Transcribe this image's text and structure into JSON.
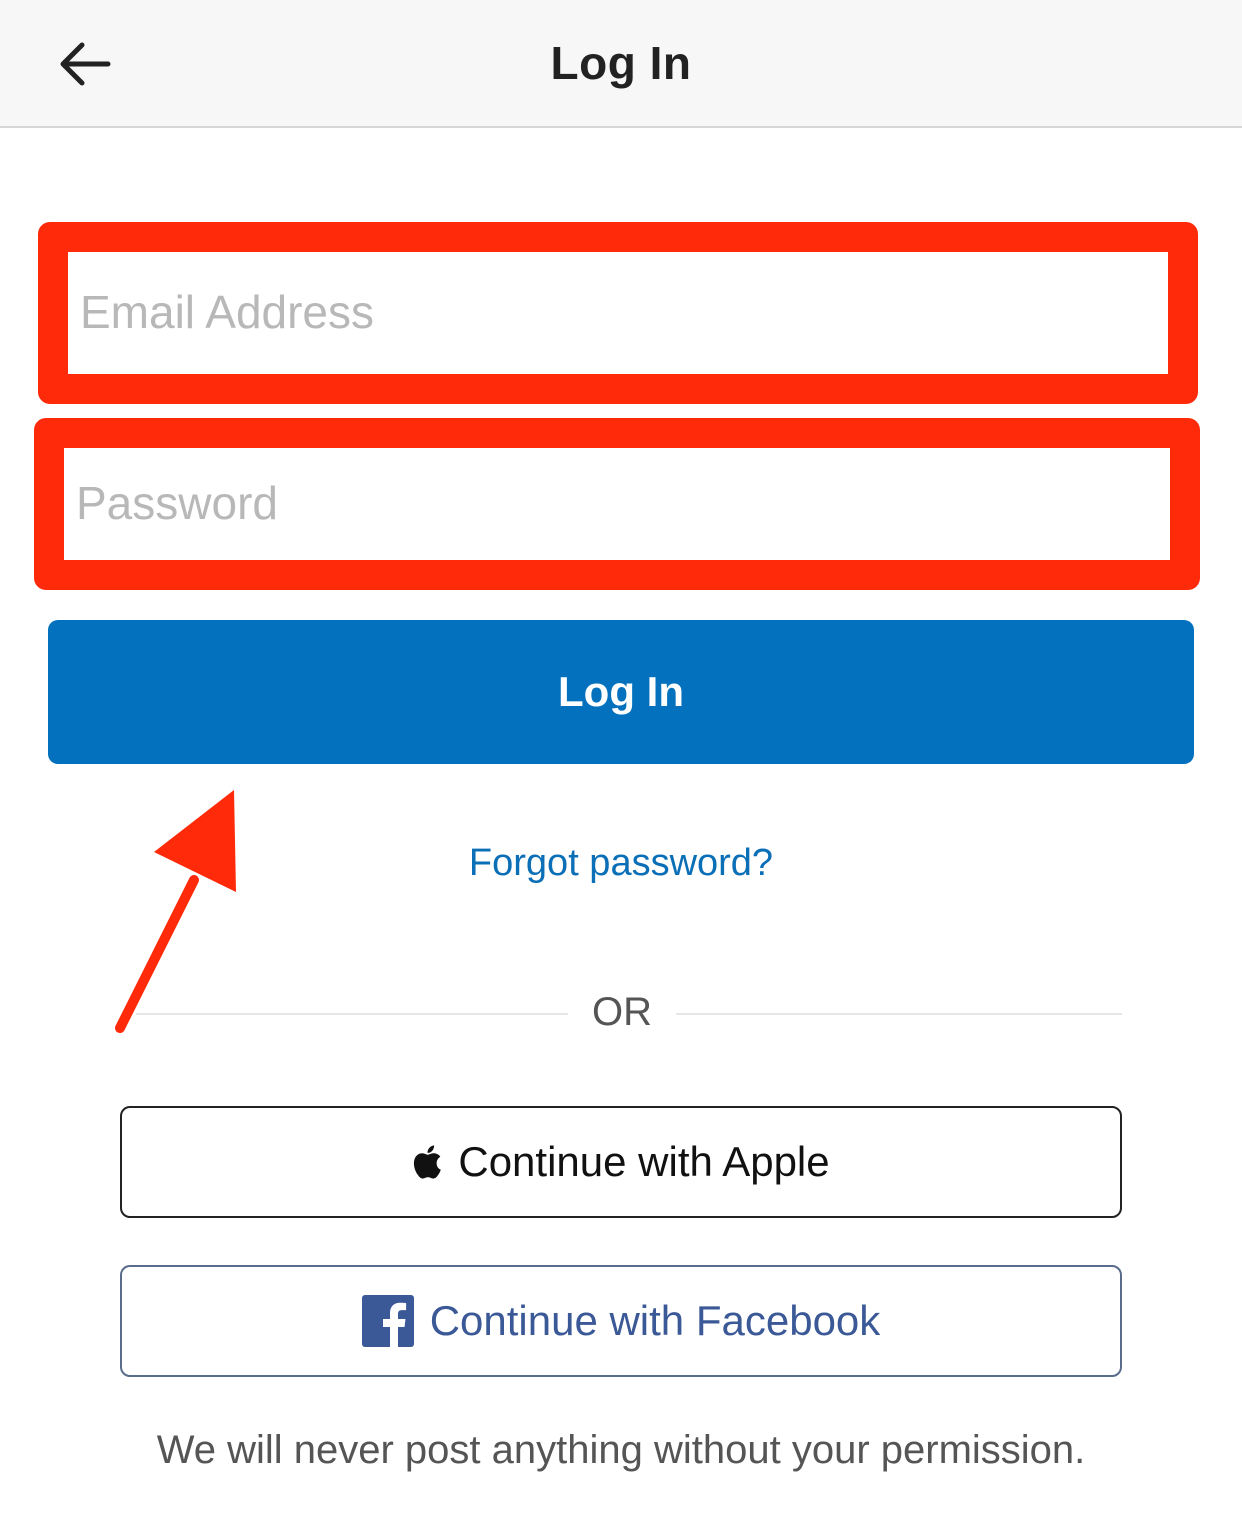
{
  "header": {
    "title": "Log In",
    "back_icon": "arrow-left-icon"
  },
  "form": {
    "email_placeholder": "Email Address",
    "email_value": "",
    "password_placeholder": "Password",
    "password_value": "",
    "login_label": "Log In",
    "forgot_label": "Forgot password?"
  },
  "divider": {
    "label": "OR"
  },
  "social": {
    "apple_label": "Continue with Apple",
    "apple_icon": "apple-logo-icon",
    "facebook_label": "Continue with Facebook",
    "facebook_icon": "facebook-logo-icon"
  },
  "footer": {
    "note": "We will never post anything without your permission."
  },
  "colors": {
    "primary": "#0371bd",
    "link": "#0b6fb7",
    "annotation": "#ff2a0a",
    "facebook": "#3b5997"
  }
}
